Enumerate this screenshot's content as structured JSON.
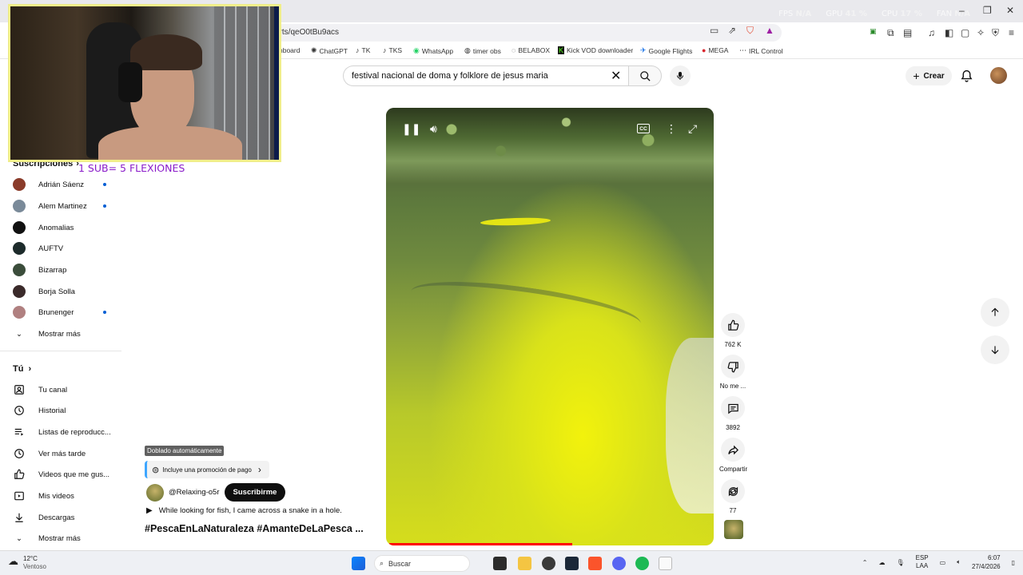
{
  "overlay_stats": [
    {
      "label": "FPS",
      "value": "N/A"
    },
    {
      "label": "GPU",
      "value": "41 %"
    },
    {
      "label": "CPU",
      "value": "17 %"
    },
    {
      "label": "FAN",
      "value": "N/A"
    }
  ],
  "browser": {
    "url": "orts/qeO0tBu9acs",
    "bookmarks": [
      "hboard",
      "ChatGPT",
      "TK",
      "TKS",
      "WhatsApp",
      "timer obs",
      "BELABOX",
      "Kick VOD downloader",
      "Google Flights",
      "MEGA",
      "IRL Control"
    ]
  },
  "masthead": {
    "search_value": "festival nacional de doma y folklore de jesus maria",
    "create_label": "Crear"
  },
  "sidebar": {
    "subscriptions_title": "Suscripciones",
    "subscriptions": [
      {
        "name": "Adrián Sáenz",
        "new": true,
        "color": "#8a3b2a"
      },
      {
        "name": "Alem Martinez",
        "new": true,
        "color": "#7a8a99"
      },
      {
        "name": "Anomalias",
        "new": false,
        "color": "#111111"
      },
      {
        "name": "AUFTV",
        "new": false,
        "color": "#1d2b2b"
      },
      {
        "name": "Bizarrap",
        "new": false,
        "color": "#3b4d3b"
      },
      {
        "name": "Borja Solla",
        "new": false,
        "color": "#3a2a2a"
      },
      {
        "name": "Brunenger",
        "new": true,
        "color": "#b08080"
      }
    ],
    "show_more_1": "Mostrar más",
    "you_title": "Tú",
    "you_items": [
      {
        "label": "Tu canal",
        "icon": "channel-icon"
      },
      {
        "label": "Historial",
        "icon": "history-icon"
      },
      {
        "label": "Listas de reproducc...",
        "icon": "playlists-icon"
      },
      {
        "label": "Ver más tarde",
        "icon": "watch-later-icon"
      },
      {
        "label": "Videos que me gus...",
        "icon": "liked-icon"
      },
      {
        "label": "Mis videos",
        "icon": "my-videos-icon"
      },
      {
        "label": "Descargas",
        "icon": "downloads-icon"
      }
    ],
    "show_more_2": "Mostrar más"
  },
  "stream_overlay": {
    "promo_text": "1 SUB= 5 FLEXIONES"
  },
  "short": {
    "dub_badge": "Doblado automáticamente",
    "paid_promo": "Incluye una promoción de pago",
    "channel_handle": "@Relaxing-o5r",
    "subscribe_label": "Suscribirme",
    "title": "While looking for fish, I came across a snake in a hole.",
    "hashtags": "#PescaEnLaNaturaleza #AmanteDeLaPesca ...",
    "progress": 0.57,
    "actions": {
      "likes": "762 K",
      "dislike_label": "No me ...",
      "comments": "3892",
      "share_label": "Compartir",
      "remix": "77"
    },
    "cc_label": "CC"
  },
  "taskbar": {
    "temperature": "12°C",
    "weather": "Ventoso",
    "search_label": "Buscar",
    "lang_line1": "ESP",
    "lang_line2": "LAA",
    "time": "6:07",
    "date": "27/4/2026"
  },
  "colors": {
    "accent_red": "#ff0000",
    "dot_blue": "#065fd4",
    "promo_purple": "#8a1cc9",
    "webcam_border": "#f0ee8a"
  }
}
